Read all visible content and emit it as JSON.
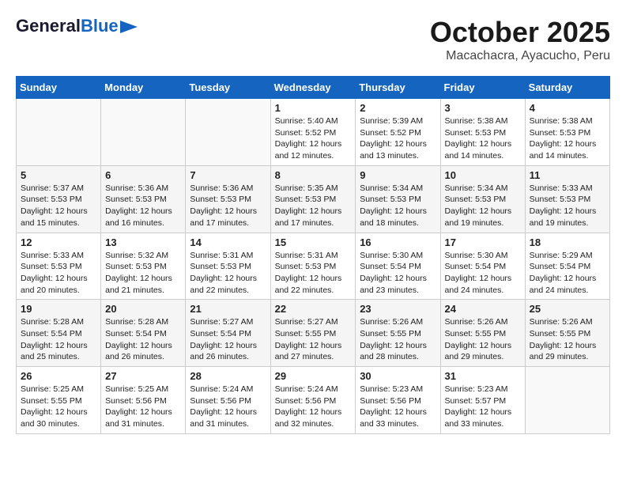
{
  "header": {
    "logo_general": "General",
    "logo_blue": "Blue",
    "month_year": "October 2025",
    "location": "Macachacra, Ayacucho, Peru"
  },
  "weekdays": [
    "Sunday",
    "Monday",
    "Tuesday",
    "Wednesday",
    "Thursday",
    "Friday",
    "Saturday"
  ],
  "weeks": [
    [
      {
        "day": "",
        "info": ""
      },
      {
        "day": "",
        "info": ""
      },
      {
        "day": "",
        "info": ""
      },
      {
        "day": "1",
        "info": "Sunrise: 5:40 AM\nSunset: 5:52 PM\nDaylight: 12 hours and 12 minutes."
      },
      {
        "day": "2",
        "info": "Sunrise: 5:39 AM\nSunset: 5:52 PM\nDaylight: 12 hours and 13 minutes."
      },
      {
        "day": "3",
        "info": "Sunrise: 5:38 AM\nSunset: 5:53 PM\nDaylight: 12 hours and 14 minutes."
      },
      {
        "day": "4",
        "info": "Sunrise: 5:38 AM\nSunset: 5:53 PM\nDaylight: 12 hours and 14 minutes."
      }
    ],
    [
      {
        "day": "5",
        "info": "Sunrise: 5:37 AM\nSunset: 5:53 PM\nDaylight: 12 hours and 15 minutes."
      },
      {
        "day": "6",
        "info": "Sunrise: 5:36 AM\nSunset: 5:53 PM\nDaylight: 12 hours and 16 minutes."
      },
      {
        "day": "7",
        "info": "Sunrise: 5:36 AM\nSunset: 5:53 PM\nDaylight: 12 hours and 17 minutes."
      },
      {
        "day": "8",
        "info": "Sunrise: 5:35 AM\nSunset: 5:53 PM\nDaylight: 12 hours and 17 minutes."
      },
      {
        "day": "9",
        "info": "Sunrise: 5:34 AM\nSunset: 5:53 PM\nDaylight: 12 hours and 18 minutes."
      },
      {
        "day": "10",
        "info": "Sunrise: 5:34 AM\nSunset: 5:53 PM\nDaylight: 12 hours and 19 minutes."
      },
      {
        "day": "11",
        "info": "Sunrise: 5:33 AM\nSunset: 5:53 PM\nDaylight: 12 hours and 19 minutes."
      }
    ],
    [
      {
        "day": "12",
        "info": "Sunrise: 5:33 AM\nSunset: 5:53 PM\nDaylight: 12 hours and 20 minutes."
      },
      {
        "day": "13",
        "info": "Sunrise: 5:32 AM\nSunset: 5:53 PM\nDaylight: 12 hours and 21 minutes."
      },
      {
        "day": "14",
        "info": "Sunrise: 5:31 AM\nSunset: 5:53 PM\nDaylight: 12 hours and 22 minutes."
      },
      {
        "day": "15",
        "info": "Sunrise: 5:31 AM\nSunset: 5:53 PM\nDaylight: 12 hours and 22 minutes."
      },
      {
        "day": "16",
        "info": "Sunrise: 5:30 AM\nSunset: 5:54 PM\nDaylight: 12 hours and 23 minutes."
      },
      {
        "day": "17",
        "info": "Sunrise: 5:30 AM\nSunset: 5:54 PM\nDaylight: 12 hours and 24 minutes."
      },
      {
        "day": "18",
        "info": "Sunrise: 5:29 AM\nSunset: 5:54 PM\nDaylight: 12 hours and 24 minutes."
      }
    ],
    [
      {
        "day": "19",
        "info": "Sunrise: 5:28 AM\nSunset: 5:54 PM\nDaylight: 12 hours and 25 minutes."
      },
      {
        "day": "20",
        "info": "Sunrise: 5:28 AM\nSunset: 5:54 PM\nDaylight: 12 hours and 26 minutes."
      },
      {
        "day": "21",
        "info": "Sunrise: 5:27 AM\nSunset: 5:54 PM\nDaylight: 12 hours and 26 minutes."
      },
      {
        "day": "22",
        "info": "Sunrise: 5:27 AM\nSunset: 5:55 PM\nDaylight: 12 hours and 27 minutes."
      },
      {
        "day": "23",
        "info": "Sunrise: 5:26 AM\nSunset: 5:55 PM\nDaylight: 12 hours and 28 minutes."
      },
      {
        "day": "24",
        "info": "Sunrise: 5:26 AM\nSunset: 5:55 PM\nDaylight: 12 hours and 29 minutes."
      },
      {
        "day": "25",
        "info": "Sunrise: 5:26 AM\nSunset: 5:55 PM\nDaylight: 12 hours and 29 minutes."
      }
    ],
    [
      {
        "day": "26",
        "info": "Sunrise: 5:25 AM\nSunset: 5:55 PM\nDaylight: 12 hours and 30 minutes."
      },
      {
        "day": "27",
        "info": "Sunrise: 5:25 AM\nSunset: 5:56 PM\nDaylight: 12 hours and 31 minutes."
      },
      {
        "day": "28",
        "info": "Sunrise: 5:24 AM\nSunset: 5:56 PM\nDaylight: 12 hours and 31 minutes."
      },
      {
        "day": "29",
        "info": "Sunrise: 5:24 AM\nSunset: 5:56 PM\nDaylight: 12 hours and 32 minutes."
      },
      {
        "day": "30",
        "info": "Sunrise: 5:23 AM\nSunset: 5:56 PM\nDaylight: 12 hours and 33 minutes."
      },
      {
        "day": "31",
        "info": "Sunrise: 5:23 AM\nSunset: 5:57 PM\nDaylight: 12 hours and 33 minutes."
      },
      {
        "day": "",
        "info": ""
      }
    ]
  ]
}
